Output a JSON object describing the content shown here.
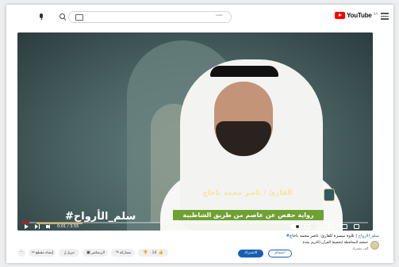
{
  "header": {
    "logo_text": "YouTube",
    "logo_region": "SA",
    "search_placeholder": "بحث"
  },
  "player": {
    "channel_watermark": "#سلم_الأرواح",
    "reciter_caption": "القارئ / ناصر محمد باحاج",
    "riwaya_caption": "رواية حفص عن عاصم من طريق الشاطبية",
    "timecode": "0:01 / 3:55",
    "progress": 0.02,
    "accent_color": "#ff0000",
    "caption_bar_color": "#6ea132"
  },
  "video": {
    "hashtag": "#سلم_الأرواح",
    "title": " | تلاوة ميسرة للقارئ: ناصر محمد باحاج"
  },
  "channel": {
    "name": "جمعية المحافظة لتحفيظ القرآن الكريم بجدة",
    "subs": "ألف مشترك",
    "join_label": "انضمام",
    "subscribe_label": "الاشتراك"
  },
  "actions": {
    "like_count": "14",
    "share_label": "مشاركة",
    "remix_label": "الريمكس",
    "download_label": "تنزيل",
    "clip_label": "إنشاء مقطع",
    "more_label": "···"
  }
}
